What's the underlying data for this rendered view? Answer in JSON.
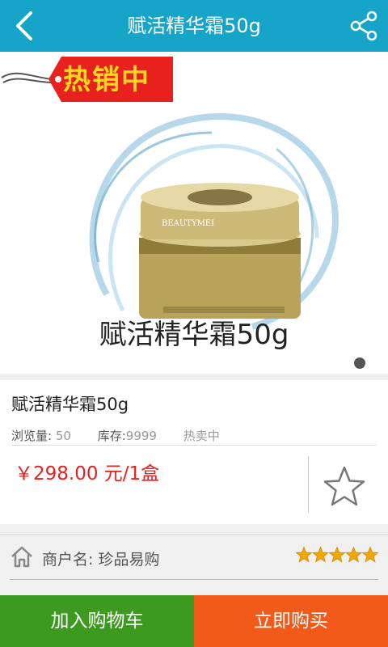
{
  "header": {
    "title": "赋活精华霜50g",
    "back_icon": "chevron-left-icon",
    "share_icon": "share-icon",
    "background": "#16a4c8"
  },
  "banner": {
    "tag_text": "热销中",
    "brand_text": "BEAUTYMEI",
    "caption": "赋活精华霜50g",
    "page_count": 1,
    "active_page": 1
  },
  "product": {
    "name": "赋活精华霜50g",
    "views_label": "浏览量:",
    "views_value": "50",
    "stock_label": "库存:",
    "stock_value": "9999",
    "status": "热卖中",
    "price": "￥298.00 元/1盒",
    "price_color": "#e8201e",
    "favorite_icon": "star-outline-icon"
  },
  "merchant": {
    "icon": "home-icon",
    "label": "商户名: 珍品易购",
    "rating": 5,
    "rating_max": 5,
    "rating_color": "#f0a800"
  },
  "footer": {
    "add_to_cart": "加入购物车",
    "add_to_cart_color": "#3c9a1f",
    "buy_now": "立即购买",
    "buy_now_color": "#f25a1c"
  }
}
